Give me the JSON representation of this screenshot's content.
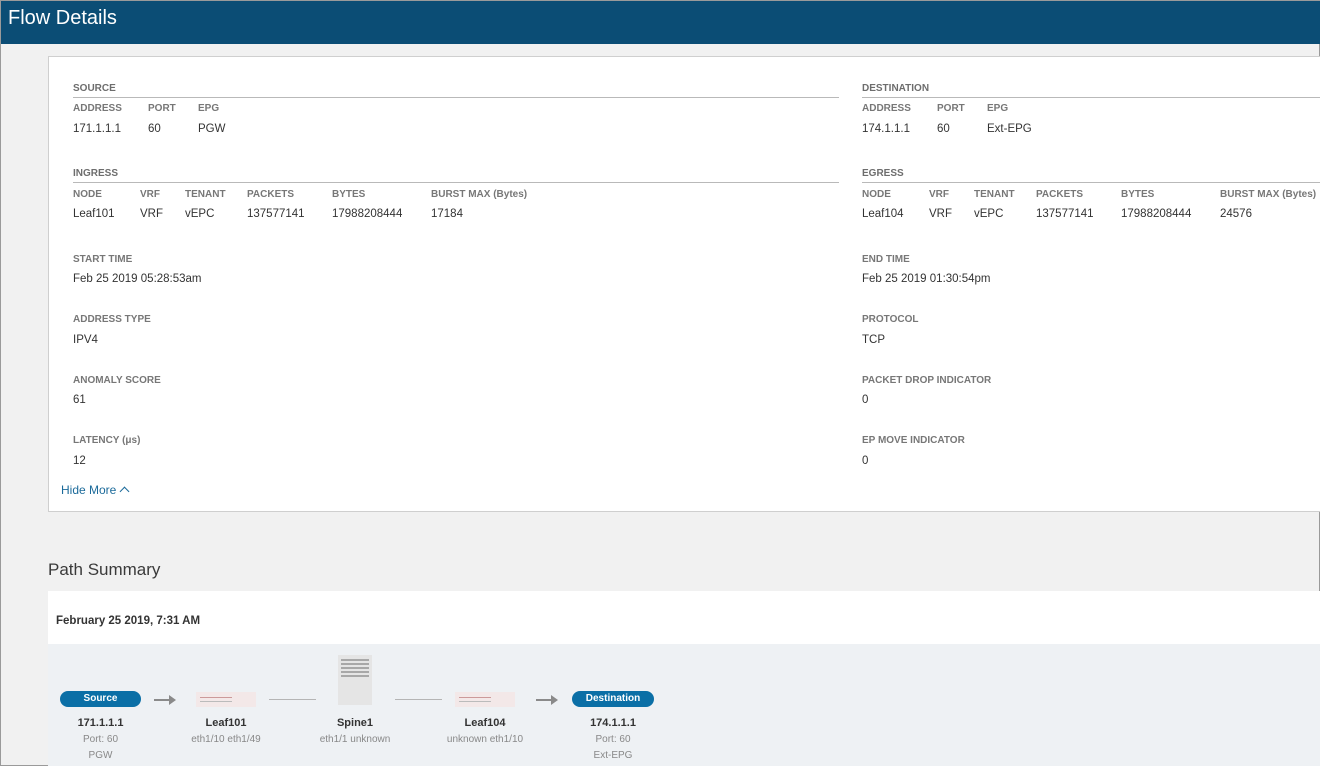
{
  "window": {
    "title": "Flow Details"
  },
  "source": {
    "header": "SOURCE",
    "columns": [
      "ADDRESS",
      "PORT",
      "EPG"
    ],
    "values": [
      "171.1.1.1",
      "60",
      "PGW"
    ]
  },
  "destination": {
    "header": "DESTINATION",
    "columns": [
      "ADDRESS",
      "PORT",
      "EPG"
    ],
    "values": [
      "174.1.1.1",
      "60",
      "Ext-EPG"
    ]
  },
  "ingress": {
    "header": "INGRESS",
    "columns": [
      "NODE",
      "VRF",
      "TENANT",
      "PACKETS",
      "BYTES",
      "BURST MAX (Bytes)"
    ],
    "values": [
      "Leaf101",
      "VRF",
      "vEPC",
      "137577141",
      "17988208444",
      "17184"
    ]
  },
  "egress": {
    "header": "EGRESS",
    "columns": [
      "NODE",
      "VRF",
      "TENANT",
      "PACKETS",
      "BYTES",
      "BURST MAX (Bytes)"
    ],
    "values": [
      "Leaf104",
      "VRF",
      "vEPC",
      "137577141",
      "17988208444",
      "24576"
    ]
  },
  "fields": {
    "start_time": {
      "label": "START TIME",
      "value": "Feb 25 2019 05:28:53am"
    },
    "end_time": {
      "label": "END TIME",
      "value": "Feb 25 2019 01:30:54pm"
    },
    "address_type": {
      "label": "ADDRESS TYPE",
      "value": "IPV4"
    },
    "protocol": {
      "label": "PROTOCOL",
      "value": "TCP"
    },
    "anomaly_score": {
      "label": "ANOMALY SCORE",
      "value": "61"
    },
    "packet_drop": {
      "label": "PACKET DROP INDICATOR",
      "value": "0"
    },
    "latency": {
      "label": "LATENCY (μs)",
      "value": "12"
    },
    "ep_move": {
      "label": "EP MOVE INDICATOR",
      "value": "0"
    }
  },
  "hide_more_label": "Hide More",
  "path_summary": {
    "title": "Path Summary",
    "date": "February 25 2019, 7:31 AM",
    "source": {
      "pill": "Source",
      "address": "171.1.1.1",
      "port": "Port: 60",
      "epg": "PGW"
    },
    "leaf101": {
      "name": "Leaf101",
      "ports": "eth1/10 eth1/49"
    },
    "spine1": {
      "name": "Spine1",
      "ports": "eth1/1 unknown"
    },
    "leaf104": {
      "name": "Leaf104",
      "ports": "unknown eth1/10"
    },
    "destination": {
      "pill": "Destination",
      "address": "174.1.1.1",
      "port": "Port: 60",
      "epg": "Ext-EPG"
    }
  },
  "colors": {
    "titlebar": "#0b4d75",
    "accent": "#0b6fa6",
    "link": "#1b6a9a"
  }
}
